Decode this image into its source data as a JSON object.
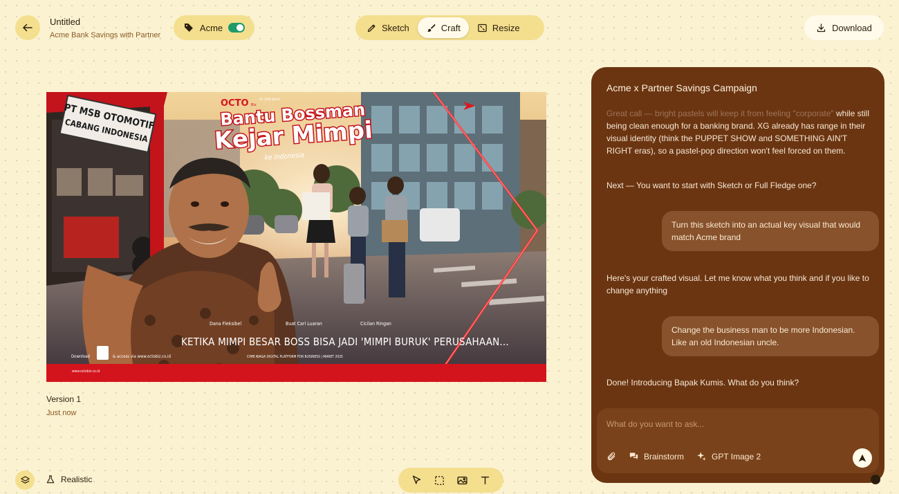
{
  "header": {
    "doc_title": "Untitled",
    "doc_subtitle": "Acme Bank Savings with Partner",
    "brand_label": "Acme",
    "brand_enabled": true,
    "modes": [
      {
        "label": "Sketch",
        "icon": "pencil-icon",
        "active": false
      },
      {
        "label": "Craft",
        "icon": "brush-icon",
        "active": true
      },
      {
        "label": "Resize",
        "icon": "resize-icon",
        "active": false
      }
    ],
    "download_label": "Download"
  },
  "artwork": {
    "brand_logo": "OCTO",
    "brand_logo_sub": "Biz",
    "cobrand_text": "BY CIMB NIAGA",
    "headline_line1": "Bantu Bossman",
    "headline_line2": "Kejar Mimpi",
    "headline_sub": "ke Indonesia",
    "shop_sign_line1": "PT MSB OTOMOTIF",
    "shop_sign_line2": "CABANG INDONESIA",
    "captions": [
      "Dana Fleksibel",
      "Buat Cari Luaran",
      "Cicilan Ringan"
    ],
    "tagline": "KETIKA MIMPI BESAR BOSS BISA JADI 'MIMPI BURUK' PERUSAHAAN...",
    "download_text": "Download",
    "access_text": "& access via www.octobiz.co.id",
    "platform_text": "CIMB NIAGA DIGITAL PLATFORM FOR BUSINESS | MARET 2025",
    "footer_url": "www.octobiz.co.id",
    "colors": {
      "brand_red": "#d4141c",
      "sky": "#e9c98f"
    }
  },
  "canvas": {
    "version_label": "Version 1",
    "version_time": "Just now"
  },
  "chat": {
    "title": "Acme x Partner Savings Campaign",
    "messages": [
      {
        "role": "assistant",
        "faded_text": "Great call — bright pastels will keep it from feeling \"corporate\"",
        "text": " while still being clean enough for a banking brand. XG already has range in their visual identity (think the PUPPET SHOW and SOMETHING AIN'T RIGHT eras), so a pastel-pop direction won't feel forced on them."
      },
      {
        "role": "assistant",
        "text": "Next — You want to start with Sketch or Full Fledge one?"
      },
      {
        "role": "user",
        "text": "Turn this sketch into an actual key visual that would match Acme brand"
      },
      {
        "role": "assistant",
        "text": "Here's your crafted visual. Let me know what you think and if you like to change anything"
      },
      {
        "role": "user",
        "text": "Change the business man to be more Indonesian. Like an old Indonesian uncle."
      },
      {
        "role": "assistant",
        "text": "Done! Introducing Bapak Kumis. What do you think?"
      }
    ],
    "composer": {
      "placeholder": "What do you want to ask...",
      "value": "",
      "tools": [
        {
          "label": "",
          "icon": "paperclip-icon"
        },
        {
          "label": "Brainstorm",
          "icon": "chat-bubbles-icon"
        },
        {
          "label": "GPT Image 2",
          "icon": "sparkle-icon"
        }
      ]
    }
  },
  "footer": {
    "style_label": "Realistic",
    "tools": [
      "select-tool",
      "marquee-tool",
      "image-tool",
      "text-tool"
    ]
  }
}
